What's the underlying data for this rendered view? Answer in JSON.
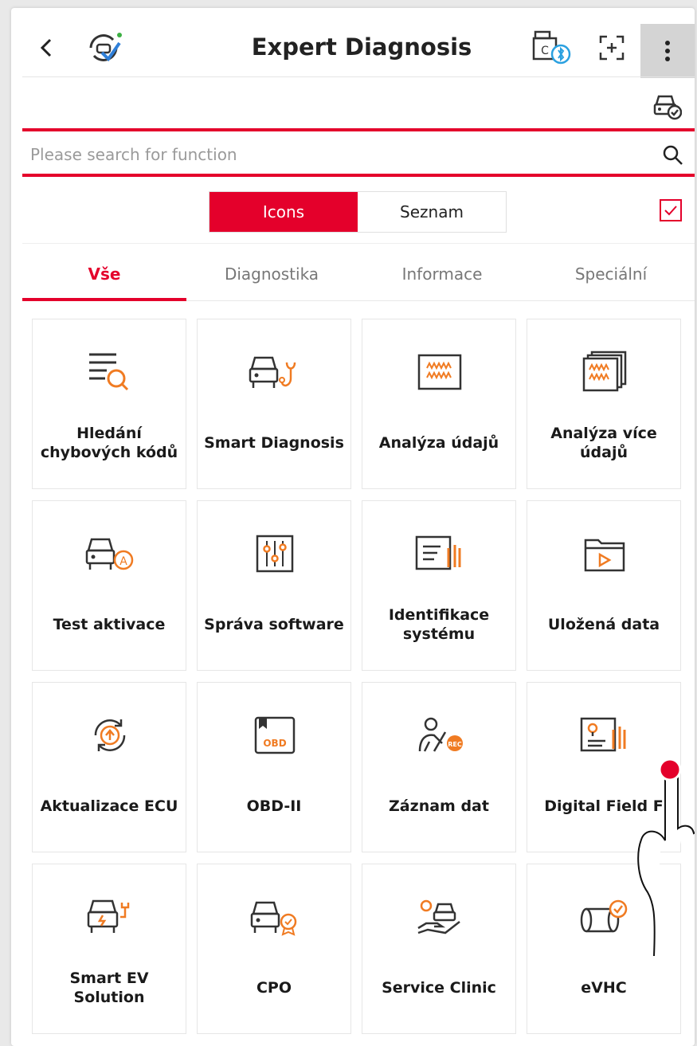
{
  "header": {
    "title": "Expert Diagnosis"
  },
  "search": {
    "placeholder": "Please search for function"
  },
  "view_toggle": {
    "icons_label": "Icons",
    "list_label": "Seznam",
    "selected": "Icons"
  },
  "filter_checked": true,
  "tabs": [
    {
      "label": "Vše",
      "active": true
    },
    {
      "label": "Diagnostika",
      "active": false
    },
    {
      "label": "Informace",
      "active": false
    },
    {
      "label": "Speciální",
      "active": false
    }
  ],
  "tiles": [
    {
      "label": "Hledání\nchybových kódů",
      "icon": "dtc-search-icon"
    },
    {
      "label": "Smart Diagnosis",
      "icon": "car-stethoscope-icon"
    },
    {
      "label": "Analýza údajů",
      "icon": "data-wave-icon"
    },
    {
      "label": "Analýza více\núdajů",
      "icon": "multi-data-wave-icon"
    },
    {
      "label": "Test aktivace",
      "icon": "car-activation-icon"
    },
    {
      "label": "Správa software",
      "icon": "sliders-icon"
    },
    {
      "label": "Identifikace\nsystému",
      "icon": "system-id-icon"
    },
    {
      "label": "Uložená data",
      "icon": "folder-play-icon"
    },
    {
      "label": "Aktualizace ECU",
      "icon": "ecu-update-icon"
    },
    {
      "label": "OBD-II",
      "icon": "obd-icon"
    },
    {
      "label": "Záznam dat",
      "icon": "record-data-icon"
    },
    {
      "label": "Digital Field F",
      "icon": "field-kit-icon"
    },
    {
      "label": "Smart EV\nSolution",
      "icon": "ev-car-icon"
    },
    {
      "label": "CPO",
      "icon": "car-certified-icon"
    },
    {
      "label": "Service Clinic",
      "icon": "service-clinic-icon"
    },
    {
      "label": "eVHC",
      "icon": "evhc-icon"
    }
  ],
  "colors": {
    "accent": "#e4002b",
    "icon_dark": "#333333",
    "icon_orange": "#f07b22"
  }
}
